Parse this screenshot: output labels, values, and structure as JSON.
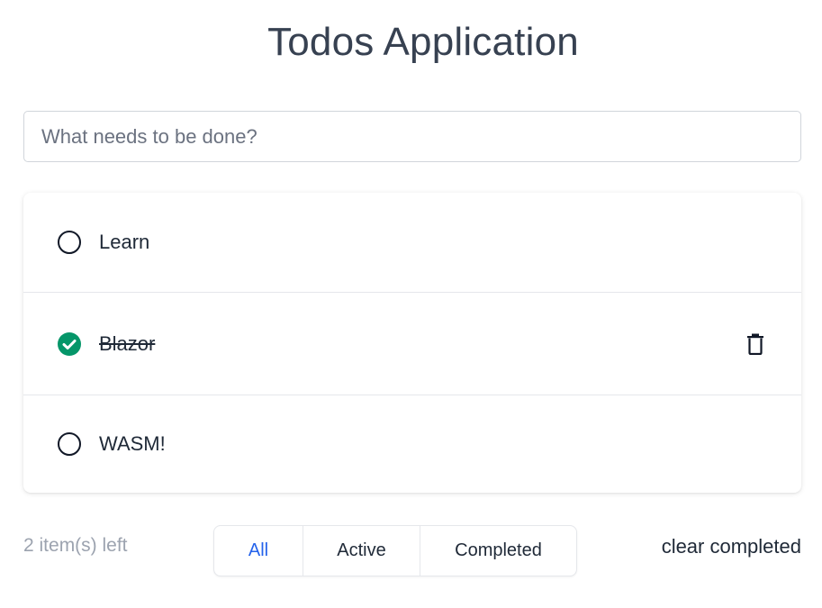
{
  "app": {
    "title": "Todos Application"
  },
  "new_todo": {
    "placeholder": "What needs to be done?",
    "value": ""
  },
  "todos": [
    {
      "text": "Learn",
      "completed": false
    },
    {
      "text": "Blazor",
      "completed": true
    },
    {
      "text": "WASM!",
      "completed": false
    }
  ],
  "footer": {
    "items_left": "2 item(s) left",
    "filters": [
      {
        "label": "All",
        "selected": true
      },
      {
        "label": "Active",
        "selected": false
      },
      {
        "label": "Completed",
        "selected": false
      }
    ],
    "clear_label": "clear completed"
  },
  "colors": {
    "accent": "#2563eb",
    "completed": "#059669",
    "muted": "#9ca3af"
  },
  "icons": {
    "incomplete": "circle-outline-icon",
    "complete": "check-circle-icon",
    "delete": "trash-icon"
  }
}
